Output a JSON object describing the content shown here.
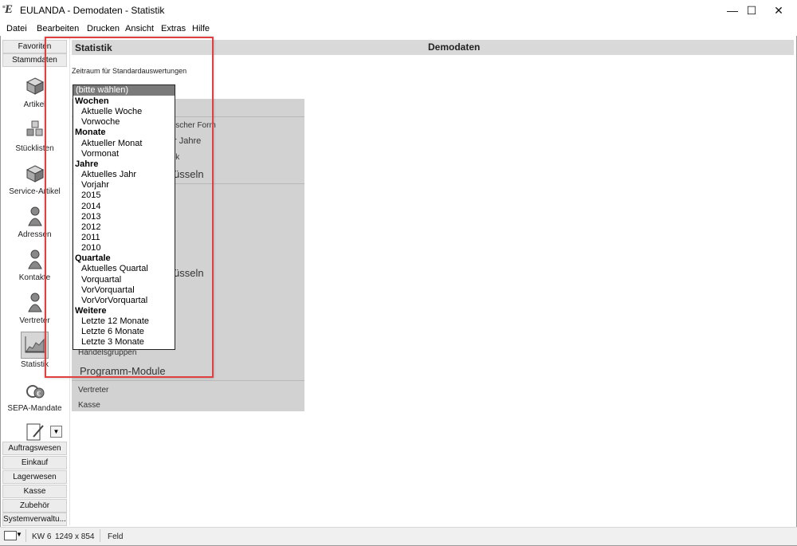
{
  "window": {
    "title": "EULANDA - Demodaten - Statistik",
    "controls": {
      "minimize": "—",
      "maximize": "☐",
      "close": "✕"
    }
  },
  "menu": [
    "Datei",
    "Bearbeiten",
    "Drucken",
    "Ansicht",
    "Extras",
    "Hilfe"
  ],
  "sidebar": {
    "top_headers": [
      "Favoriten",
      "Stammdaten"
    ],
    "items": [
      "Artikel",
      "Stücklisten",
      "Service-Artikel",
      "Adressen",
      "Kontakte",
      "Vertreter",
      "Statistik",
      "SEPA-Mandate"
    ],
    "selected": "Statistik",
    "bottom_headers": [
      "Auftragswesen",
      "Einkauf",
      "Lagerwesen",
      "Kasse",
      "Zubehör",
      "Systemverwaltu..."
    ]
  },
  "content": {
    "title": "Statistik",
    "database": "Demodaten",
    "period_label": "Zeitraum für Standardauswertungen"
  },
  "background_panel": {
    "fragments": [
      "ischer Form",
      "r Jahre",
      "ik",
      "üsseln",
      "üsseln"
    ],
    "items": [
      "Handelsgruppen",
      "Programm-Module",
      "Vertreter",
      "Kasse"
    ]
  },
  "dropdown": {
    "selected": "(bitte wählen)",
    "groups": [
      {
        "label": "Wochen",
        "options": [
          "Aktuelle Woche",
          "Vorwoche"
        ]
      },
      {
        "label": "Monate",
        "options": [
          "Aktueller Monat",
          "Vormonat"
        ]
      },
      {
        "label": "Jahre",
        "options": [
          "Aktuelles Jahr",
          "Vorjahr",
          "2015",
          "2014",
          "2013",
          "2012",
          "2011",
          "2010"
        ]
      },
      {
        "label": "Quartale",
        "options": [
          "Aktuelles Quartal",
          "Vorquartal",
          "VorVorquartal",
          "VorVorVorquartal"
        ]
      },
      {
        "label": "Weitere",
        "options": [
          "Letzte 12 Monate",
          "Letzte 6 Monate",
          "Letzte 3 Monate"
        ]
      }
    ]
  },
  "statusbar": {
    "week": "KW 6",
    "resolution": "1249 x 854",
    "field": "Feld"
  },
  "colors": {
    "highlight": "#e04040",
    "panel": "#d2d2d2",
    "header": "#d9d9d9"
  }
}
